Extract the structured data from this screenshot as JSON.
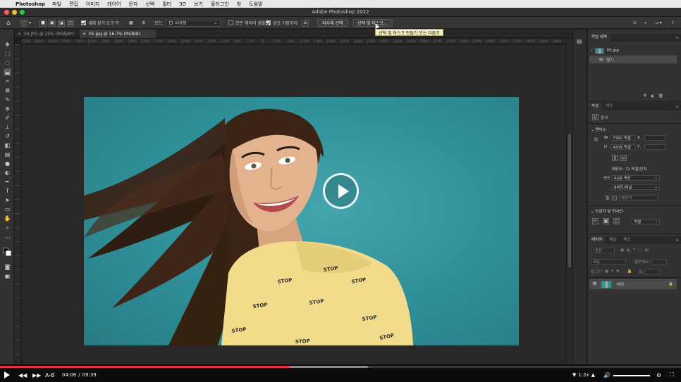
{
  "menubar": {
    "apple": "",
    "app_name": "Photoshop",
    "items": [
      "파일",
      "편집",
      "이미지",
      "레이어",
      "문자",
      "선택",
      "필터",
      "3D",
      "보기",
      "플러그인",
      "창",
      "도움말"
    ]
  },
  "window": {
    "title": "Adobe Photoshop 2022"
  },
  "options_bar": {
    "sample_all_layers": "개체 찾기 도구",
    "mode_label": "모드:",
    "mode_value": "사각형",
    "all_layers_sample": "모든 레이어 샘플링",
    "hard_edge": "공간 가장자리",
    "select_subject": "피사체 선택",
    "select_and_mask": "선택 및 마스크..."
  },
  "tooltip": {
    "text": "선택 및 마스크 만들기 또는 다듬기"
  },
  "tabs": [
    {
      "label": "04.JPG @ 25% (RGB/8*)",
      "close": "×"
    },
    {
      "label": "05.jpg @ 16.7% (RGB/8)",
      "close": "×"
    }
  ],
  "ruler_labels": [
    "7200",
    "6800",
    "6400",
    "6000",
    "5600",
    "5200",
    "4800",
    "4400",
    "4000",
    "3600",
    "3200",
    "2800",
    "2400",
    "2000",
    "1600",
    "1200",
    "800",
    "400",
    "0",
    "400",
    "800",
    "1200",
    "1600",
    "2000",
    "2400",
    "2800",
    "3200",
    "3600",
    "4000",
    "4400",
    "4800",
    "5200",
    "5600",
    "6000",
    "6400",
    "6800",
    "7200",
    "7600",
    "8000",
    "8400",
    "8800"
  ],
  "photo": {
    "shirt_text": "STOP",
    "colors": {
      "background": "#2f8f98",
      "shirt": "#f2dc8c",
      "hair": "#3b2416",
      "skin": "#e2b38e"
    }
  },
  "history_panel": {
    "tab": "작업 내역",
    "snapshot": "05.jpg",
    "step": "열기"
  },
  "properties_panel": {
    "tabs": [
      "속성",
      "색상"
    ],
    "document_label": "문서",
    "canvas_header": "캔버스",
    "w_label": "W",
    "w_value": "7360 픽셀",
    "x_label": "X",
    "h_label": "H",
    "h_value": "4209 픽셀",
    "y_label": "Y",
    "resolution": "해상도: 72 픽셀/인치",
    "mode_label": "모드",
    "mode_value": "RGB 색상",
    "depth_value": "8비트/채널",
    "fill_label": "칠",
    "fill_value": "배경색",
    "rulers_header": "눈금자 및 안내선",
    "unit_value": "픽셀"
  },
  "layers_panel": {
    "tabs": [
      "레이어",
      "채널",
      "패스"
    ],
    "kind_placeholder": "종류",
    "blend_mode": "표준",
    "opacity_label": "불투명도:",
    "lock_label": "잠그기:",
    "fill_label": "칠:",
    "layer_name": "배경"
  },
  "player": {
    "current_time": "04:06",
    "separator": "/",
    "duration": "09:39",
    "ab_label": "A-B",
    "speed": "1.2x",
    "progress": 0.425,
    "buffered": 0.54,
    "volume": 1.0
  }
}
